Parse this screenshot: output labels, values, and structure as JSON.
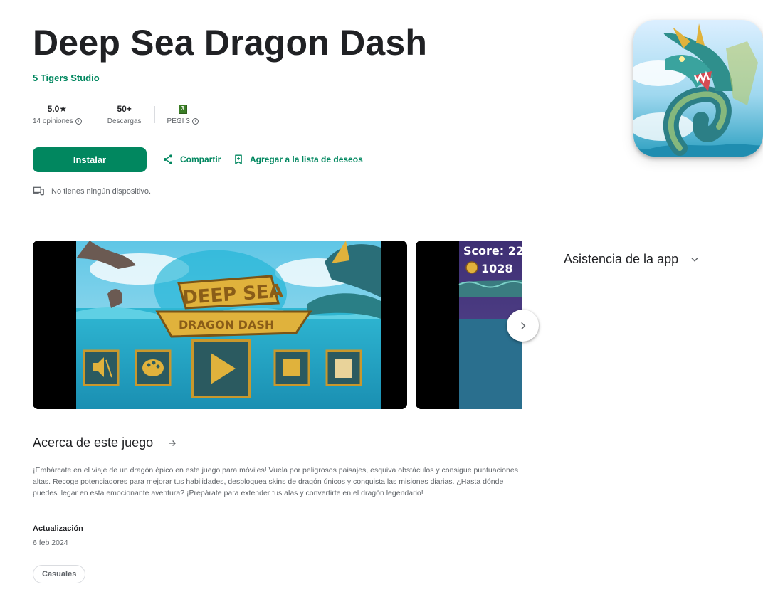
{
  "app": {
    "title": "Deep Sea Dragon Dash",
    "developer": "5 Tigers Studio",
    "icon": "deep-sea-dragon-app-icon"
  },
  "stats": {
    "rating_value": "5.0★",
    "rating_label": "14 opiniones",
    "downloads_value": "50+",
    "downloads_label": "Descargas",
    "pegi_label": "PEGI 3",
    "pegi_badge": "3"
  },
  "actions": {
    "install": "Instalar",
    "share": "Compartir",
    "wishlist": "Agregar a la lista de deseos"
  },
  "device_notice": "No tienes ningún dispositivo.",
  "screenshots": {
    "shot1_title_line1": "DEEP SEA",
    "shot1_title_line2": "DRAGON DASH",
    "shot2_score": "Score: 22",
    "shot2_coins": "1028"
  },
  "support": {
    "label": "Asistencia de la app"
  },
  "about": {
    "heading": "Acerca de este juego",
    "body": "¡Embárcate en el viaje de un dragón épico en este juego para móviles! Vuela por peligrosos paisajes, esquiva obstáculos y consigue puntuaciones altas. Recoge potenciadores para mejorar tus habilidades, desbloquea skins de dragón únicos y conquista las misiones diarias. ¿Hasta dónde puedes llegar en esta emocionante aventura? ¡Prepárate para extender tus alas y convertirte en el dragón legendario!",
    "updated_label": "Actualización",
    "updated_value": "6 feb 2024",
    "category_chip": "Casuales"
  },
  "colors": {
    "brand_green": "#01875f",
    "text_primary": "#202124",
    "text_secondary": "#5f6368"
  }
}
